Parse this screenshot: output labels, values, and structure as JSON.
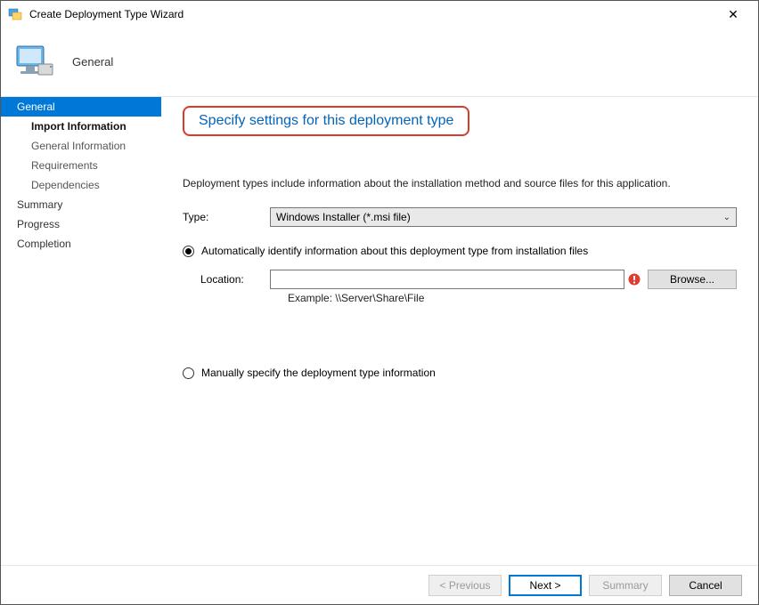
{
  "window": {
    "title": "Create Deployment Type Wizard"
  },
  "header": {
    "page_title": "General"
  },
  "sidebar": {
    "items": [
      {
        "label": "General"
      },
      {
        "label": "Import Information"
      },
      {
        "label": "General Information"
      },
      {
        "label": "Requirements"
      },
      {
        "label": "Dependencies"
      },
      {
        "label": "Summary"
      },
      {
        "label": "Progress"
      },
      {
        "label": "Completion"
      }
    ]
  },
  "content": {
    "heading": "Specify settings for this deployment type",
    "description": "Deployment types include information about the installation method and source files for this application.",
    "type_label": "Type:",
    "type_value": "Windows Installer (*.msi file)",
    "radio_auto": "Automatically identify information about this deployment type from installation files",
    "location_label": "Location:",
    "location_value": "",
    "browse_label": "Browse...",
    "example_label": "Example: \\\\Server\\Share\\File",
    "radio_manual": "Manually specify the deployment type information"
  },
  "footer": {
    "previous": "< Previous",
    "next": "Next >",
    "summary": "Summary",
    "cancel": "Cancel"
  }
}
